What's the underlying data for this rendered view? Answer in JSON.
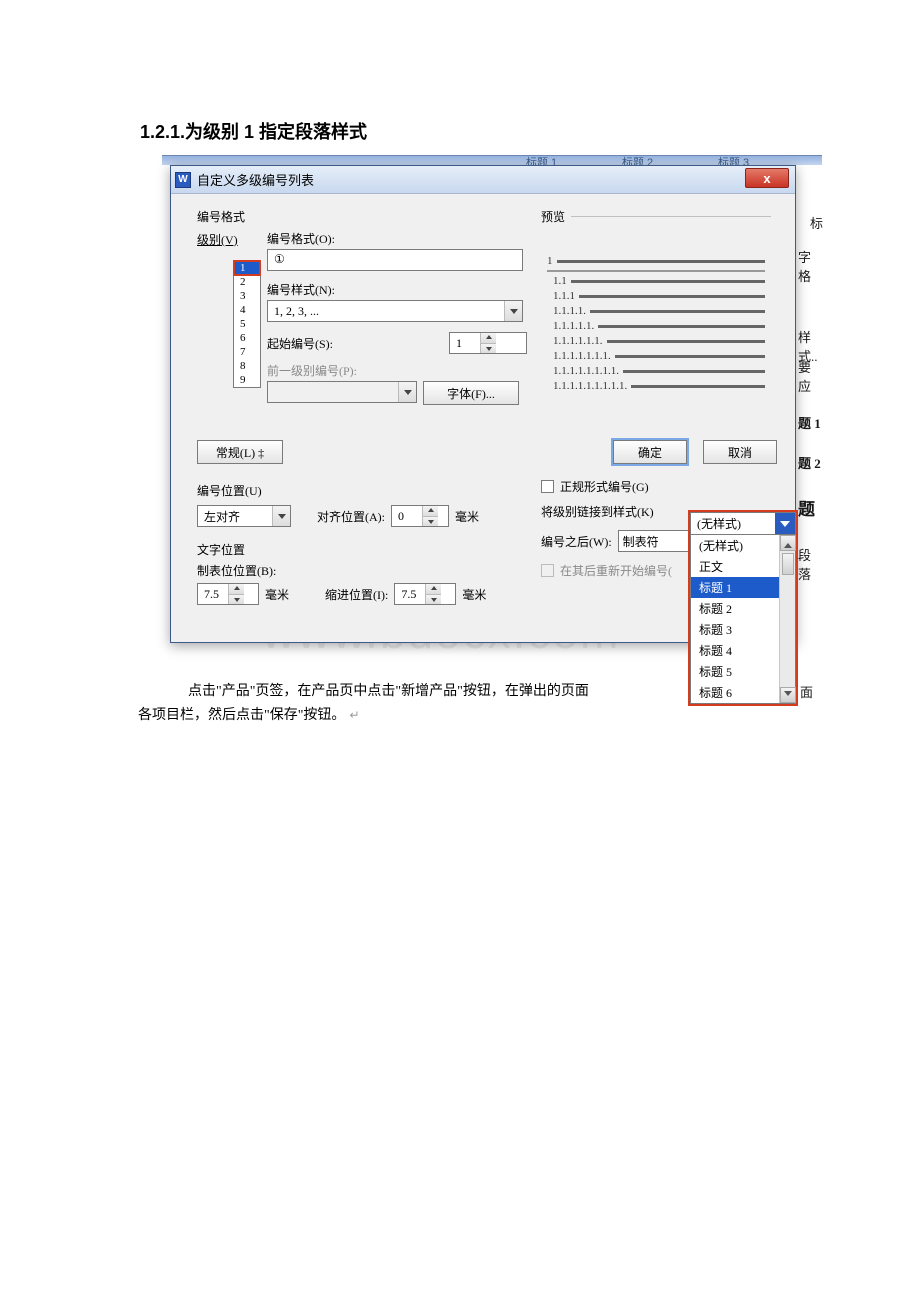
{
  "page_heading": "1.2.1.为级别 1 指定段落样式",
  "bg_tabs": {
    "t1": "标题 1",
    "t2": "标题 2",
    "t3": "标题 3"
  },
  "bg_frag": {
    "f1": "标",
    "f2": "字格",
    "f3": "样式..",
    "f4": "要应",
    "f5": "题 1",
    "f6": "题 2",
    "f7": "题",
    "f8": "段落",
    "f9": "面"
  },
  "dialog": {
    "title": "自定义多级编号列表",
    "close_label": "x",
    "section_nf": "编号格式",
    "section_preview": "预览",
    "level_label": "级别(V)",
    "levels": [
      "1",
      "2",
      "3",
      "4",
      "5",
      "6",
      "7",
      "8",
      "9"
    ],
    "selected_level": "1",
    "nf_format_label": "编号格式(O):",
    "nf_format_value": "①",
    "nf_style_label": "编号样式(N):",
    "nf_style_value": "1, 2, 3, ...",
    "nf_start_label": "起始编号(S):",
    "nf_start_value": "1",
    "nf_prev_label": "前一级别编号(P):",
    "font_btn": "字体(F)...",
    "preview_items": [
      "1",
      "1.1",
      "1.1.1",
      "1.1.1.1.",
      "1.1.1.1.1.",
      "1.1.1.1.1.1.",
      "1.1.1.1.1.1.1.",
      "1.1.1.1.1.1.1.1.",
      "1.1.1.1.1.1.1.1.1."
    ],
    "mode_btn": "常规(L) ‡",
    "ok_btn": "确定",
    "cancel_btn": "取消",
    "num_pos_section": "编号位置(U)",
    "align_value": "左对齐",
    "align_pos_label": "对齐位置(A):",
    "align_pos_value": "0",
    "unit_mm": "毫米",
    "text_pos_section": "文字位置",
    "tab_pos_label": "制表位位置(B):",
    "tab_pos_value": "7.5",
    "indent_label": "缩进位置(I):",
    "indent_value": "7.5",
    "chk_formal_label": "正规形式编号(G)",
    "link_label": "将级别链接到样式(K)",
    "link_value": "(无样式)",
    "after_label": "编号之后(W):",
    "after_value": "制表符",
    "chk_restart_label": "在其后重新开始编号(",
    "dropdown_items": [
      "(无样式)",
      "正文",
      "标题 1",
      "标题 2",
      "标题 3",
      "标题 4",
      "标题 5",
      "标题 6"
    ],
    "dropdown_selected": "标题 1"
  },
  "watermark": "www.bdocx.com",
  "body_para1": "点击\"产品\"页签，在产品页中点击\"新增产品\"按钮，在弹出的页面",
  "body_para2": "各项目栏，然后点击\"保存\"按钮。"
}
